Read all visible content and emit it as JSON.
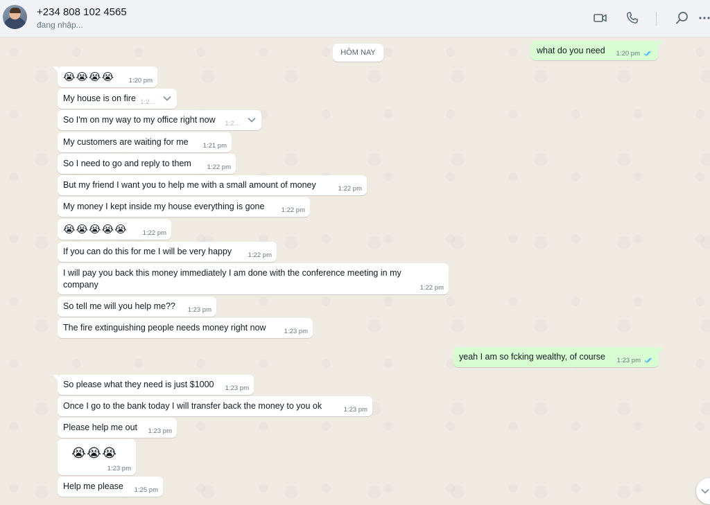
{
  "header": {
    "contact_name": "+234 808 102 4565",
    "status": "đang nhập...",
    "icons": [
      "video-call-icon",
      "voice-call-icon",
      "search-icon",
      "more-options-icon"
    ]
  },
  "chat": {
    "date_chip": "HÔM NAY",
    "messages": [
      {
        "dir": "out",
        "text": "what do you need",
        "time": "1:20 pm",
        "ticks": "read"
      },
      {
        "dir": "in",
        "text": "😭😭😭😭",
        "time": "1:20 pm"
      },
      {
        "dir": "in",
        "text": "My house is on fire",
        "time": "1:2…",
        "menu": true
      },
      {
        "dir": "in",
        "text": "So I'm on my way to my office right now",
        "time": "1:2…",
        "menu": true
      },
      {
        "dir": "in",
        "text": "My customers are waiting for me",
        "time": "1:21 pm"
      },
      {
        "dir": "in",
        "text": "So I need to go and reply to them",
        "time": "1:22 pm"
      },
      {
        "dir": "in",
        "text": "But my friend I want you to help me with a small amount of money",
        "time": "1:22 pm"
      },
      {
        "dir": "in",
        "text": "My money I kept inside my house everything is gone",
        "time": "1:22 pm"
      },
      {
        "dir": "in",
        "text": "😭😭😭😭😭",
        "time": "1:22 pm"
      },
      {
        "dir": "in",
        "text": "If you can do this for me I will be very happy",
        "time": "1:22 pm"
      },
      {
        "dir": "in",
        "text": "I will pay you back this money immediately I am done with the conference meeting in my company",
        "time": "1:22 pm"
      },
      {
        "dir": "in",
        "text": "So tell me will you help me??",
        "time": "1:23 pm"
      },
      {
        "dir": "in",
        "text": "The fire extinguishing people needs money right now",
        "time": "1:23 pm"
      },
      {
        "dir": "out",
        "text": "yeah I am so fcking wealthy, of course",
        "time": "1:23 pm",
        "ticks": "read"
      },
      {
        "dir": "in",
        "text": "So please what they need is just $1000",
        "time": "1:23 pm"
      },
      {
        "dir": "in",
        "text": "Once I go to the bank today I will transfer back the money to you ok",
        "time": "1:23 pm"
      },
      {
        "dir": "in",
        "text": "Please help me out",
        "time": "1:23 pm"
      },
      {
        "dir": "in",
        "text": "😭😭😭",
        "time": "1:23 pm"
      },
      {
        "dir": "in",
        "text": "Help me please",
        "time": "1:25 pm"
      }
    ]
  },
  "colors": {
    "incoming_bubble": "#ffffff",
    "outgoing_bubble": "#d9fdd3",
    "chat_background": "#efeae2",
    "read_ticks": "#53bdeb"
  }
}
